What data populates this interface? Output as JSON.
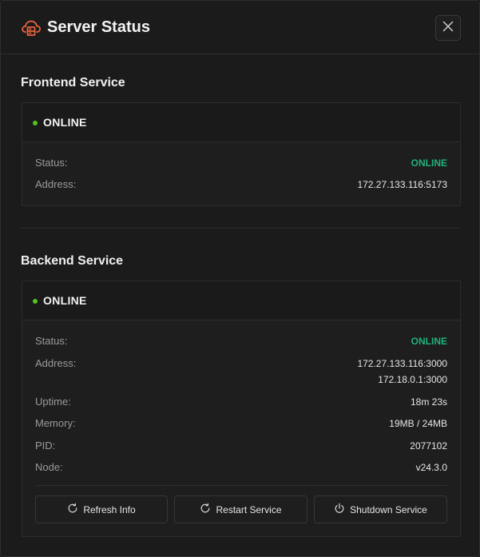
{
  "header": {
    "title": "Server Status",
    "close_label": "Close"
  },
  "frontend": {
    "section_title": "Frontend Service",
    "state": "ONLINE",
    "rows": [
      {
        "key": "Status:",
        "value": "ONLINE"
      },
      {
        "key": "Address:",
        "value": "172.27.133.116:5173"
      }
    ]
  },
  "backend": {
    "section_title": "Backend Service",
    "state": "ONLINE",
    "status_key": "Status:",
    "status_value": "ONLINE",
    "address_key": "Address:",
    "address_values": [
      "172.27.133.116:3000",
      "172.18.0.1:3000"
    ],
    "uptime_key": "Uptime:",
    "uptime_value": "18m 23s",
    "memory_key": "Memory:",
    "memory_value": "19MB / 24MB",
    "pid_key": "PID:",
    "pid_value": "2077102",
    "node_key": "Node:",
    "node_value": "v24.3.0"
  },
  "actions": {
    "refresh": "Refresh Info",
    "restart": "Restart Service",
    "shutdown": "Shutdown Service"
  },
  "colors": {
    "accent": "#e8643c",
    "online": "#20b27a",
    "dot": "#52c41a"
  },
  "icons": [
    "cloud-server-icon",
    "close-icon",
    "refresh-icon",
    "restart-icon",
    "power-icon"
  ]
}
